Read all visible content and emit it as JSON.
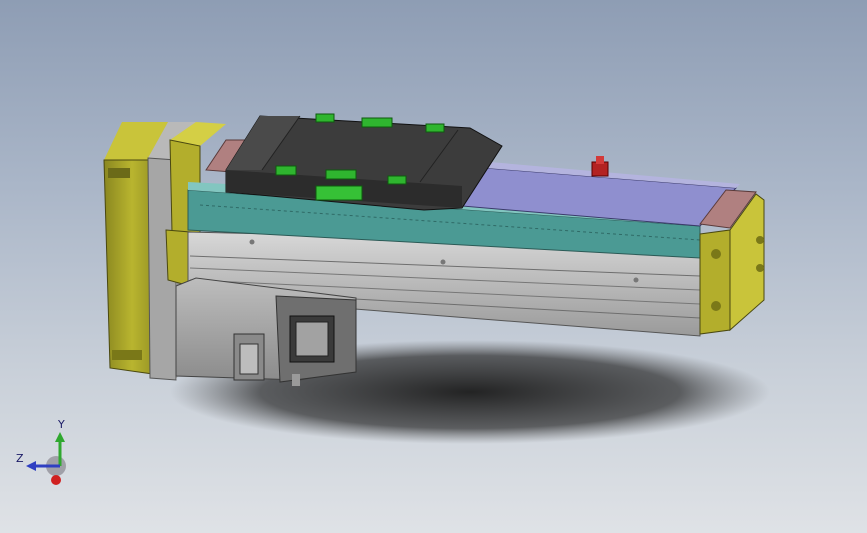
{
  "viewport": {
    "triad": {
      "x_label": "",
      "y_label": "Y",
      "z_label": "Z"
    },
    "colors": {
      "motor_housing": "#a8a528",
      "carriage": "#3a3a3a",
      "rail": "#4b9a94",
      "cover": "#8f8fcf",
      "base": "#c8c8c8",
      "connector": "#2fb52f",
      "end_plate": "#9a6a6a"
    }
  }
}
